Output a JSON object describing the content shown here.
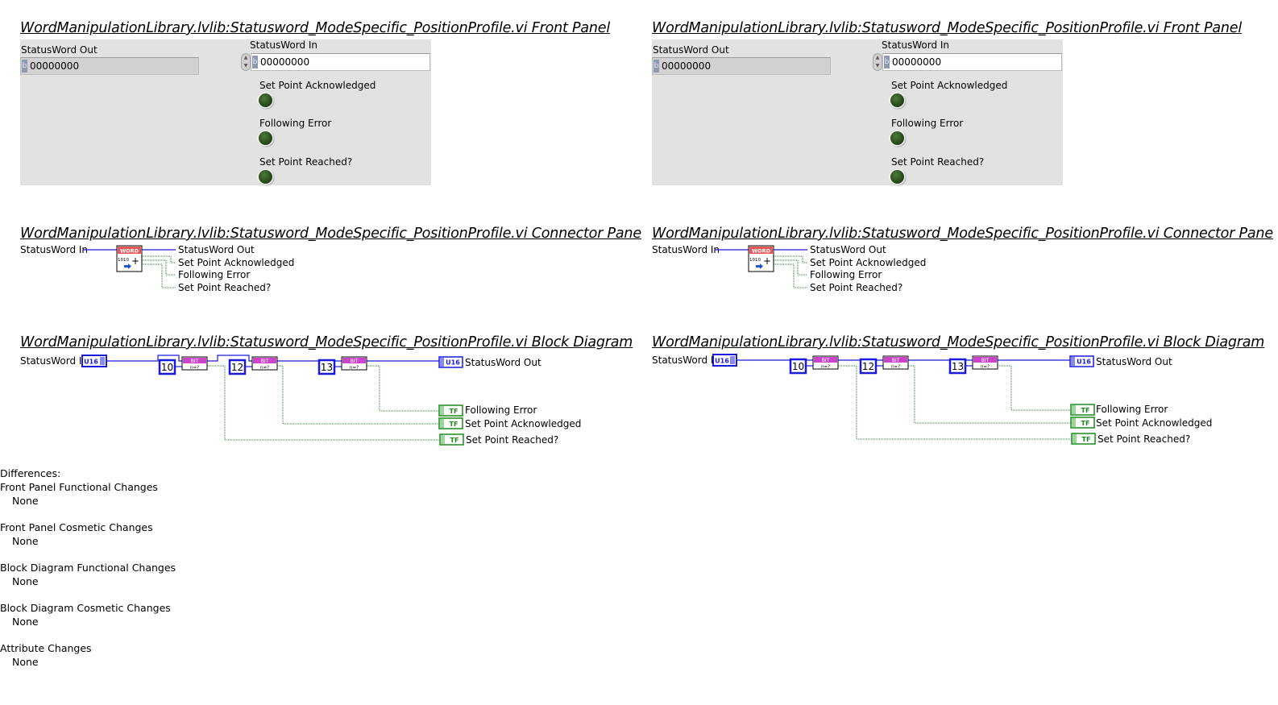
{
  "panels": [
    {
      "side": "left",
      "front_panel": {
        "title": "WordManipulationLibrary.lvlib:Statusword_ModeSpecific_PositionProfile.vi Front Panel",
        "statusword_out": {
          "label": "StatusWord Out",
          "radix": "b",
          "value": "00000000"
        },
        "statusword_in": {
          "label": "StatusWord In",
          "radix": "b",
          "value": "00000000"
        },
        "leds": [
          {
            "label": "Set Point Acknowledged",
            "state": "off"
          },
          {
            "label": "Following Error",
            "state": "off"
          },
          {
            "label": "Set Point Reached?",
            "state": "off"
          }
        ]
      },
      "connector_pane": {
        "title": "WordManipulationLibrary.lvlib:Statusword_ModeSpecific_PositionProfile.vi Connector Pane",
        "input": "StatusWord In",
        "icon_header": "WORD",
        "icon_body": "1010",
        "outputs": [
          "StatusWord Out",
          "Set Point Acknowledged",
          "Following Error",
          "Set Point Reached?"
        ]
      },
      "block_diagram": {
        "title": "WordManipulationLibrary.lvlib:Statusword_ModeSpecific_PositionProfile.vi Block Diagram",
        "input_label": "StatusWord In",
        "input_type": "U16",
        "bit_constants": [
          "10",
          "12",
          "13"
        ],
        "bit_node_header": "BIT",
        "bit_node_body": "n=?",
        "output_label": "StatusWord Out",
        "output_type": "U16",
        "bool_type": "TF",
        "bool_outputs": [
          "Following Error",
          "Set Point Acknowledged",
          "Set Point Reached?"
        ]
      }
    },
    {
      "side": "right",
      "front_panel": {
        "title": "WordManipulationLibrary.lvlib:Statusword_ModeSpecific_PositionProfile.vi Front Panel",
        "statusword_out": {
          "label": "StatusWord Out",
          "radix": "b",
          "value": "00000000"
        },
        "statusword_in": {
          "label": "StatusWord In",
          "radix": "b",
          "value": "00000000"
        },
        "leds": [
          {
            "label": "Set Point Acknowledged",
            "state": "off"
          },
          {
            "label": "Following Error",
            "state": "off"
          },
          {
            "label": "Set Point Reached?",
            "state": "off"
          }
        ]
      },
      "connector_pane": {
        "title": "WordManipulationLibrary.lvlib:Statusword_ModeSpecific_PositionProfile.vi Connector Pane",
        "input": "StatusWord In",
        "icon_header": "WORD",
        "icon_body": "1010",
        "outputs": [
          "StatusWord Out",
          "Set Point Acknowledged",
          "Following Error",
          "Set Point Reached?"
        ]
      },
      "block_diagram": {
        "title": "WordManipulationLibrary.lvlib:Statusword_ModeSpecific_PositionProfile.vi Block Diagram",
        "input_label": "StatusWord In",
        "input_type": "U16",
        "bit_constants": [
          "10",
          "12",
          "13"
        ],
        "bit_node_header": "BIT",
        "bit_node_body": "n=?",
        "output_label": "StatusWord Out",
        "output_type": "U16",
        "bool_type": "TF",
        "bool_outputs": [
          "Following Error",
          "Set Point Acknowledged",
          "Set Point Reached?"
        ]
      }
    }
  ],
  "differences": {
    "heading": "Differences:",
    "sections": [
      {
        "name": "Front Panel Functional Changes",
        "value": "None"
      },
      {
        "name": "Front Panel Cosmetic Changes",
        "value": "None"
      },
      {
        "name": "Block Diagram Functional Changes",
        "value": "None"
      },
      {
        "name": "Block Diagram Cosmetic Changes",
        "value": "None"
      },
      {
        "name": "Attribute Changes",
        "value": "None"
      }
    ]
  },
  "colors": {
    "panel_bg": "#e2e2e2",
    "u16_wire": "#1a1adc",
    "bool_wire": "#1b8a1b",
    "bit_node_header": "#cc44cc",
    "word_header": "#e85a5a",
    "led_off": "#274a1a"
  }
}
